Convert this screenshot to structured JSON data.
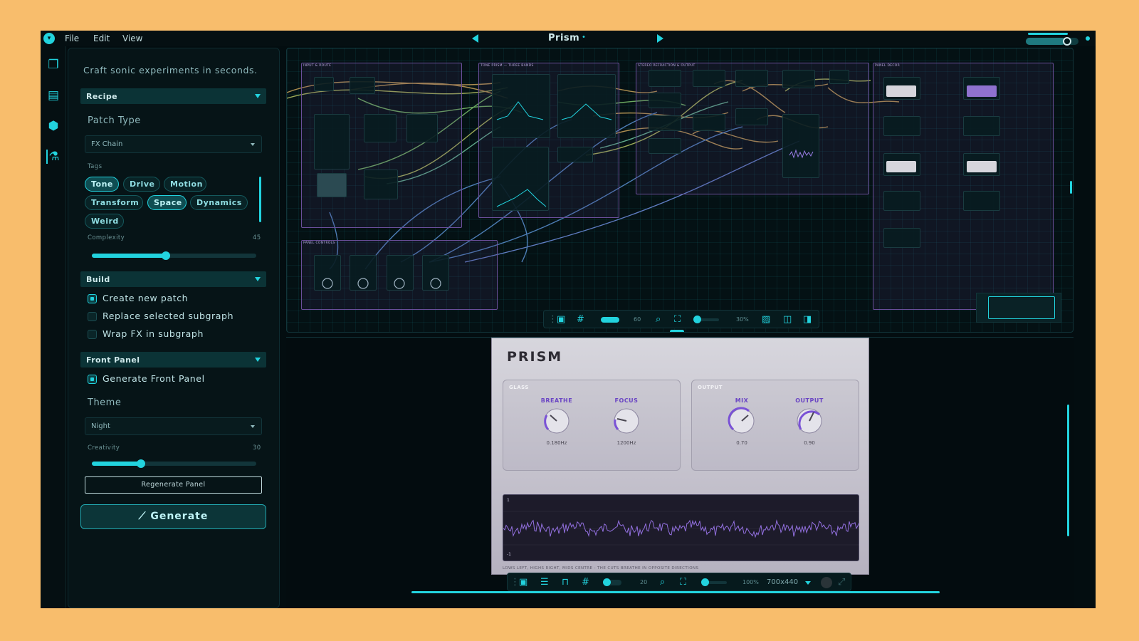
{
  "app": {
    "title": "Prism",
    "dirty_marker": "•"
  },
  "menu": {
    "file": "File",
    "edit": "Edit",
    "view": "View"
  },
  "sidebar": {
    "tagline": "Craft sonic experiments in seconds.",
    "recipe": {
      "header": "Recipe",
      "patch_type_label": "Patch Type",
      "patch_type_value": "FX Chain",
      "tags_label": "Tags",
      "tags": [
        {
          "label": "Tone",
          "selected": true
        },
        {
          "label": "Drive",
          "selected": false
        },
        {
          "label": "Motion",
          "selected": false
        },
        {
          "label": "Transform",
          "selected": false
        },
        {
          "label": "Space",
          "selected": true
        },
        {
          "label": "Dynamics",
          "selected": false
        },
        {
          "label": "Weird",
          "selected": false
        }
      ],
      "complexity_label": "Complexity",
      "complexity_value": "45",
      "complexity_fraction": 0.45
    },
    "build": {
      "header": "Build",
      "options": [
        {
          "label": "Create new patch",
          "checked": true
        },
        {
          "label": "Replace selected subgraph",
          "checked": false
        },
        {
          "label": "Wrap FX in subgraph",
          "checked": false
        }
      ]
    },
    "front_panel": {
      "header": "Front Panel",
      "generate_label": "Generate Front Panel",
      "generate_checked": true,
      "theme_label": "Theme",
      "theme_value": "Night",
      "creativity_label": "Creativity",
      "creativity_value": "30",
      "creativity_fraction": 0.3,
      "regenerate_label": "Regenerate Panel"
    },
    "generate_label": "Generate"
  },
  "graph_toolbar": {
    "grid_value": "60",
    "zoom_value": "30%"
  },
  "front_panel": {
    "title": "PRISM",
    "sections": [
      {
        "title": "GLASS",
        "knobs": [
          {
            "label": "BREATHE",
            "value": "0.180Hz"
          },
          {
            "label": "FOCUS",
            "value": "1200Hz"
          }
        ]
      },
      {
        "title": "OUTPUT",
        "knobs": [
          {
            "label": "MIX",
            "value": "0.70"
          },
          {
            "label": "OUTPUT",
            "value": "0.90"
          }
        ]
      }
    ],
    "scope_top": "1",
    "scope_bottom": "-1",
    "caption": "LOWS LEFT, HIGHS RIGHT, MIDS CENTRE - THE CUTS BREATHE IN OPPOSITE DIRECTIONS"
  },
  "panel_toolbar": {
    "grid_value": "20",
    "zoom_value": "100%",
    "size_value": "700x440"
  },
  "colors": {
    "accent": "#22d3de",
    "panel_accent": "#6a45c4",
    "background": "#030d10",
    "frame": "#f8bd6c"
  }
}
